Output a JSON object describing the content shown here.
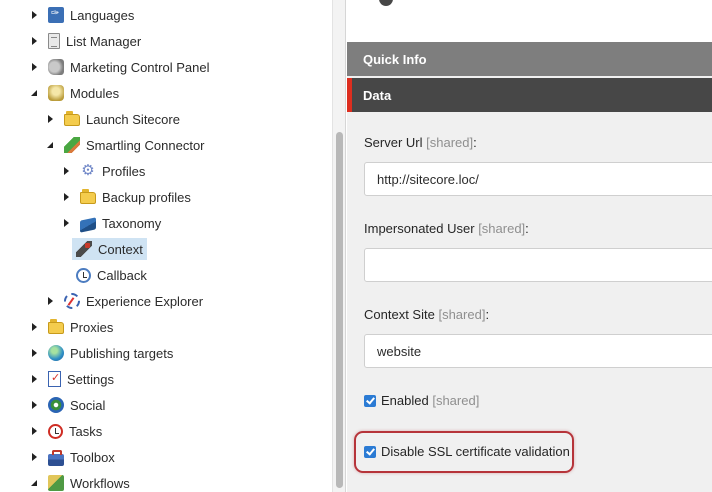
{
  "tree": {
    "items": [
      {
        "label": "Languages",
        "icon": "languages-icon",
        "expand": "collapsed"
      },
      {
        "label": "List Manager",
        "icon": "list-manager-icon",
        "expand": "collapsed"
      },
      {
        "label": "Marketing Control Panel",
        "icon": "megaphone-icon",
        "expand": "collapsed"
      },
      {
        "label": "Modules",
        "icon": "modules-icon",
        "expand": "expanded"
      },
      {
        "label": "Launch Sitecore",
        "icon": "folder-icon",
        "expand": "collapsed"
      },
      {
        "label": "Smartling Connector",
        "icon": "pencil-icon",
        "expand": "expanded"
      },
      {
        "label": "Profiles",
        "icon": "gear-icon",
        "expand": "collapsed"
      },
      {
        "label": "Backup profiles",
        "icon": "folder-icon",
        "expand": "collapsed"
      },
      {
        "label": "Taxonomy",
        "icon": "book-icon",
        "expand": "collapsed"
      },
      {
        "label": "Context",
        "icon": "usb-icon",
        "expand": "none",
        "selected": true
      },
      {
        "label": "Callback",
        "icon": "clock-icon",
        "expand": "none"
      },
      {
        "label": "Experience Explorer",
        "icon": "explorer-icon",
        "expand": "collapsed"
      },
      {
        "label": "Proxies",
        "icon": "folder-icon",
        "expand": "collapsed"
      },
      {
        "label": "Publishing targets",
        "icon": "globe-icon",
        "expand": "collapsed"
      },
      {
        "label": "Settings",
        "icon": "checklist-icon",
        "expand": "collapsed"
      },
      {
        "label": "Social",
        "icon": "social-icon",
        "expand": "collapsed"
      },
      {
        "label": "Tasks",
        "icon": "alarm-clock-icon",
        "expand": "collapsed"
      },
      {
        "label": "Toolbox",
        "icon": "toolbox-icon",
        "expand": "collapsed"
      },
      {
        "label": "Workflows",
        "icon": "workflow-icon",
        "expand": "expanded"
      }
    ]
  },
  "content": {
    "quick_info": "Quick Info",
    "data_section": "Data",
    "shared_tag": "[shared]",
    "fields": {
      "server_url": {
        "label": "Server Url",
        "value": "http://sitecore.loc/"
      },
      "impersonated_user": {
        "label": "Impersonated User",
        "value": ""
      },
      "context_site": {
        "label": "Context Site",
        "value": "website"
      }
    },
    "checkboxes": {
      "enabled": {
        "label": "Enabled",
        "checked": true
      },
      "disable_ssl": {
        "label": "Disable SSL certificate validation",
        "checked": true
      }
    }
  }
}
